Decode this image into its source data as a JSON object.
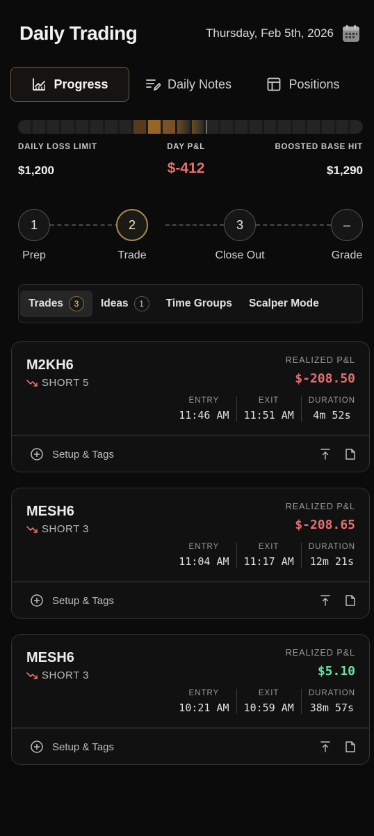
{
  "header": {
    "title": "Daily Trading",
    "date": "Thursday, Feb 5th, 2026"
  },
  "tabs": [
    {
      "label": "Progress",
      "icon": "chart-line-icon"
    },
    {
      "label": "Daily Notes",
      "icon": "notes-pen-icon"
    },
    {
      "label": "Positions",
      "icon": "table-icon"
    }
  ],
  "stats": {
    "daily_loss_limit_label": "DAILY LOSS LIMIT",
    "daily_loss_limit": "$1,200",
    "day_pnl_label": "DAY P&L",
    "day_pnl": "$-412",
    "boosted_label": "BOOSTED BASE HIT",
    "boosted": "$1,290"
  },
  "steps": [
    {
      "number": "1",
      "label": "Prep"
    },
    {
      "number": "2",
      "label": "Trade"
    },
    {
      "number": "3",
      "label": "Close Out"
    },
    {
      "number": "–",
      "label": "Grade"
    }
  ],
  "subtabs": [
    {
      "label": "Trades",
      "count": "3"
    },
    {
      "label": "Ideas",
      "count": "1"
    },
    {
      "label": "Time Groups"
    },
    {
      "label": "Scalper Mode"
    }
  ],
  "trade_labels": {
    "realized": "REALIZED P&L",
    "entry": "ENTRY",
    "exit": "EXIT",
    "duration": "DURATION",
    "setup": "Setup & Tags"
  },
  "trades": [
    {
      "symbol": "M2KH6",
      "direction": "SHORT 5",
      "pnl": "$-208.50",
      "entry": "11:46 AM",
      "exit": "11:51 AM",
      "duration": "4m 52s"
    },
    {
      "symbol": "MESH6",
      "direction": "SHORT 3",
      "pnl": "$-208.65",
      "entry": "11:04 AM",
      "exit": "11:17 AM",
      "duration": "12m 21s"
    },
    {
      "symbol": "MESH6",
      "direction": "SHORT 3",
      "pnl": "$5.10",
      "entry": "10:21 AM",
      "exit": "10:59 AM",
      "duration": "38m 57s"
    }
  ],
  "colors": {
    "accent_gold": "#a8894c",
    "negative": "#e66e6e",
    "positive": "#6ee0a0"
  }
}
